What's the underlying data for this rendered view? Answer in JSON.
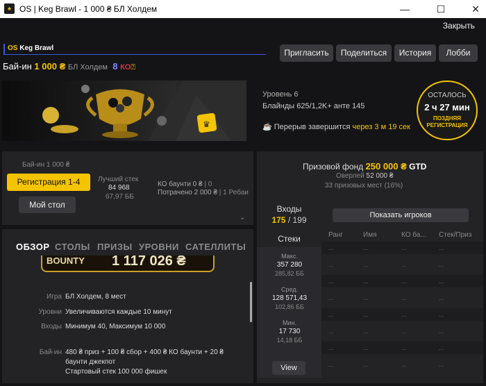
{
  "window": {
    "title": "OS | Keg Brawl - 1 000 ₴ БЛ Холдем",
    "minimize": "—",
    "maximize": "☐",
    "close": "✕"
  },
  "close_link": "Закрыть",
  "brand": {
    "os": "OS",
    "name": "Keg Brawl"
  },
  "buyin_line": {
    "label": "Бай-ин",
    "amount": "1 000 ₴",
    "game": "БЛ Холдем",
    "ko": "8",
    "ko_label": "КО"
  },
  "actions": {
    "invite": "Пригласить",
    "share": "Поделиться",
    "history": "История",
    "lobby": "Лобби"
  },
  "level_info": {
    "level": "Уровень 6",
    "blinds": "Блайнды 625/1,2K+ анте 145",
    "break_label": "Перерыв завершится",
    "break_time": "через 3 м 19 сек"
  },
  "countdown": {
    "label": "ОСТАЛОСЬ",
    "time": "2 ч 27 мин",
    "late1": "ПОЗДНЯЯ",
    "late2": "РЕГИСТРАЦИЯ"
  },
  "reg_panel": {
    "buyin": "Бай-ин 1 000 ₴",
    "register": "Регистрация 1-4",
    "my_table": "Мой стол",
    "best_stack_label": "Лучший стек",
    "best_stack": "84 968",
    "best_stack_bb": "67,97 ББ",
    "ko_bounty": "КО баунти 0 ₴",
    "ko_count": "0",
    "spent": "Потрачено 2 000 ₴",
    "rebuy": "1 Ребаи"
  },
  "tabs": [
    "ОБЗОР",
    "СТОЛЫ",
    "ПРИЗЫ",
    "УРОВНИ",
    "САТЕЛЛИТЫ"
  ],
  "bounty_banner": {
    "label": "BOUNTY",
    "amount": "1 117 026 ₴"
  },
  "details": [
    {
      "k": "Игра",
      "v": "БЛ Холдем, 8 мест"
    },
    {
      "k": "Уровни",
      "v": "Увеличиваются каждые 10 минут"
    },
    {
      "k": "Входы",
      "v": "Минимум 40, Максимум 10 000"
    },
    {
      "k": "Бай-ин",
      "v": "480 ₴ приз + 100 ₴ сбор + 400 ₴ КО баунти + 20 ₴",
      "v2": "баунти джекпот",
      "v3": "Стартовый стек 100 000 фишек"
    }
  ],
  "prize": {
    "label": "Призовой фонд",
    "amount": "250 000 ₴",
    "gtd": "GTD",
    "overlay": "Оверлей",
    "overlay_val": "52 000 ₴",
    "places": "33 призовых мест (16%)"
  },
  "entries": {
    "label": "Входы",
    "value": "175",
    "total": "/ 199"
  },
  "stacks": {
    "label": "Стеки",
    "max_k": "Макс.",
    "max_v": "357 280",
    "max_bb": "285,82 ББ",
    "avg_k": "Сред.",
    "avg_v": "128 571,43",
    "avg_bb": "102,86 ББ",
    "min_k": "Мин.",
    "min_v": "17 730",
    "min_bb": "14,18 ББ",
    "view": "View"
  },
  "players": {
    "show": "Показать игроков",
    "headers": [
      "Ранг",
      "Имя",
      "КО ба...",
      "Стек/Приз"
    ],
    "placeholder": "..."
  },
  "colors": {
    "accent": "#f5c400",
    "panel": "#232326",
    "bg": "#141416"
  }
}
